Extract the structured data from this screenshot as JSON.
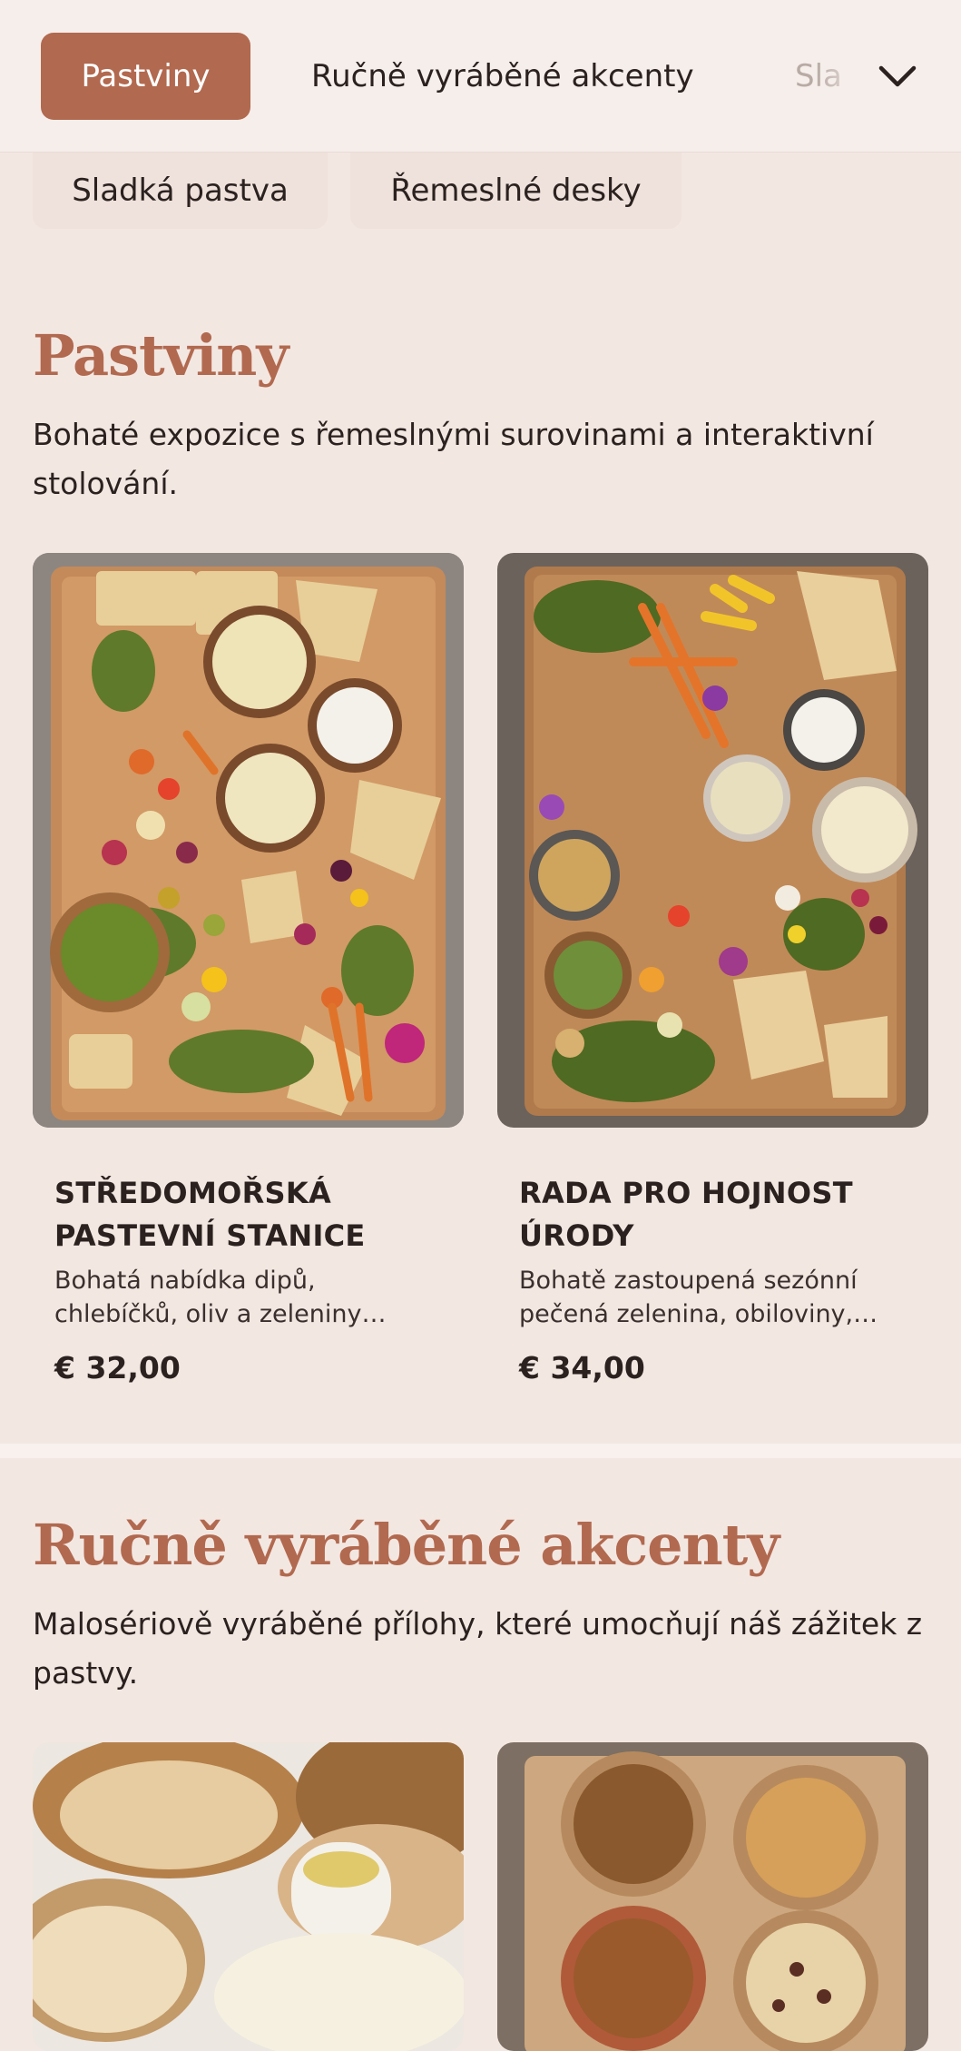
{
  "nav": {
    "tabs": [
      {
        "label": "Pastviny",
        "active": true
      },
      {
        "label": "Ručně vyráběné akcenty",
        "active": false
      },
      {
        "label": "Sladká pastva",
        "active": false
      }
    ],
    "tab3_partial": "Sla",
    "dropdown_icon": "chevron-down-icon"
  },
  "chips": [
    {
      "label": "Sladká pastva"
    },
    {
      "label": "Řemeslné desky"
    }
  ],
  "sections": [
    {
      "title": "Pastviny",
      "description": "Bohaté expozice s řemeslnými surovinami a interaktivní stolování.",
      "items": [
        {
          "title": "Středomořská pastevní stanice",
          "description": "Bohatá nabídka dipů, chlebíčků, oliv a zeleniny…",
          "price": "€ 32,00"
        },
        {
          "title": "Rada pro hojnost úrody",
          "description": "Bohatě zastoupená sezónní pečená zelenina, obiloviny, ořechy a sýry…",
          "price": "€ 34,00"
        }
      ]
    },
    {
      "title": "Ručně vyráběné akcenty",
      "description": "Malosériově vyráběné přílohy, které umocňují náš zážitek z pastvy.",
      "items": []
    }
  ],
  "colors": {
    "accent": "#b1694f",
    "background": "#f3e7e2",
    "text": "#2b221f"
  }
}
